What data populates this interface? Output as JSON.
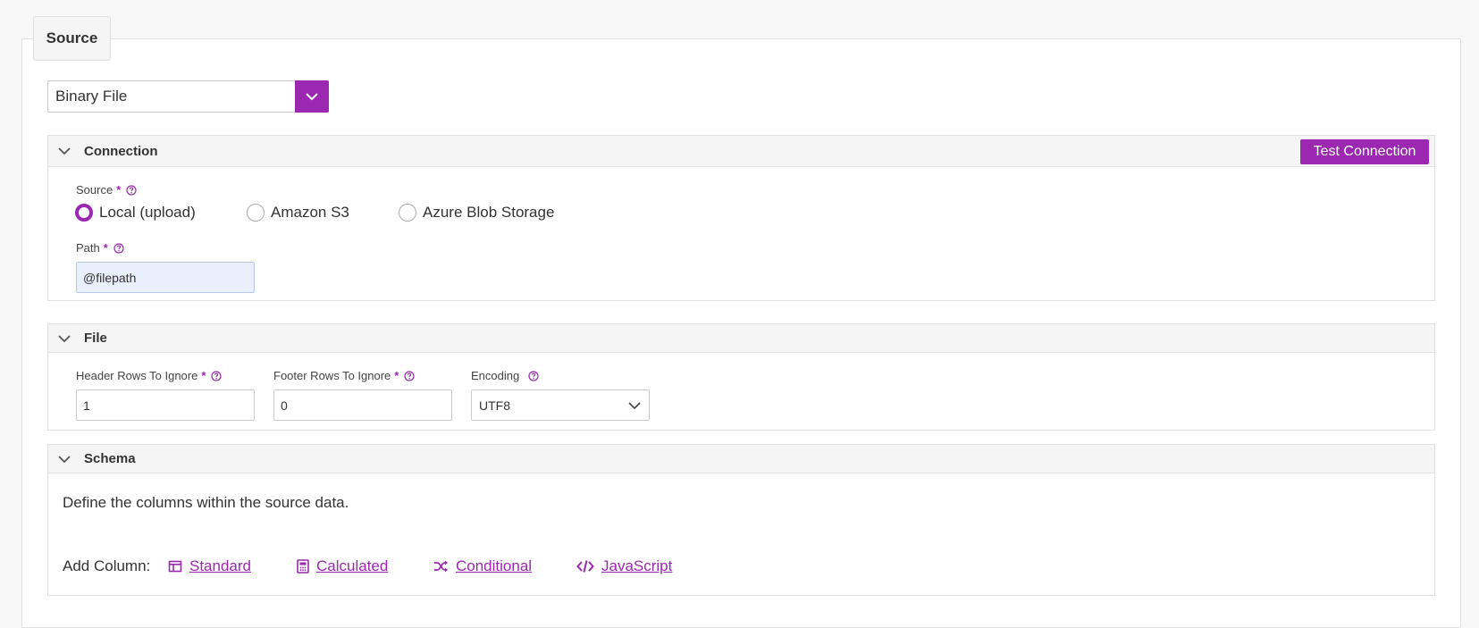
{
  "tab": {
    "label": "Source"
  },
  "source_type": {
    "value": "Binary File"
  },
  "connection": {
    "title": "Connection",
    "test_button": "Test Connection",
    "source_label": "Source",
    "required_mark": "*",
    "options": [
      "Local (upload)",
      "Amazon S3",
      "Azure Blob Storage"
    ],
    "selected_option": "Local (upload)",
    "path_label": "Path",
    "path_value": "@filepath"
  },
  "file": {
    "title": "File",
    "header_rows_label": "Header Rows To Ignore",
    "header_rows_value": "1",
    "footer_rows_label": "Footer Rows To Ignore",
    "footer_rows_value": "0",
    "encoding_label": "Encoding",
    "encoding_value": "UTF8"
  },
  "schema": {
    "title": "Schema",
    "description": "Define the columns within the source data.",
    "add_column_label": "Add Column:",
    "links": {
      "standard": "Standard",
      "calculated": "Calculated",
      "conditional": "Conditional",
      "javascript": "JavaScript"
    }
  },
  "colors": {
    "accent": "#9c27b0",
    "highlight_input": "#e8f0fe"
  },
  "icons": [
    "chevron-down-icon",
    "help-icon",
    "table-icon",
    "calculator-icon",
    "shuffle-icon",
    "code-icon"
  ]
}
